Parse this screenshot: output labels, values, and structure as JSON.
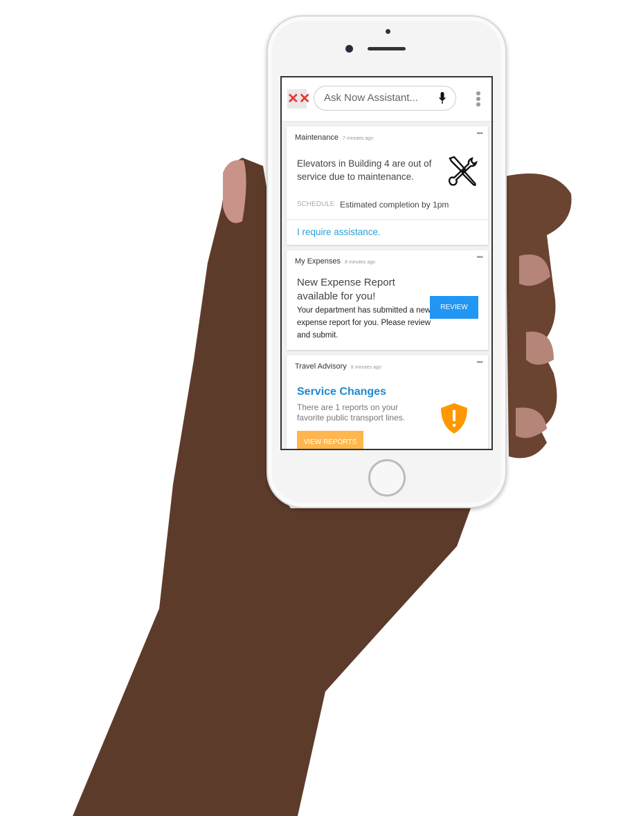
{
  "search": {
    "placeholder": "Ask Now Assistant..."
  },
  "cards": [
    {
      "category": "Maintenance",
      "time": "7 minutes ago",
      "body": "Elevators in Building 4 are out of service due to maintenance.",
      "schedule_label": "SCHEDULE",
      "schedule_text": "Estimated completion by 1pm",
      "link": "I require assistance.",
      "icon": "tools-icon"
    },
    {
      "category": "My Expenses",
      "time": "8 minutes ago",
      "title": "New Expense Report available for you!",
      "body": "Your department has submitted a new expense report for you. Please review and submit.",
      "button": "REVIEW"
    },
    {
      "category": "Travel Advisory",
      "time": "8 minutes ago",
      "title": "Service Changes",
      "body": "There are 1 reports on your favorite public transport lines.",
      "button": "VIEW REPORTS",
      "icon": "warning-shield-icon"
    }
  ],
  "colors": {
    "link": "#2a9fd8",
    "review": "#2196f3",
    "view_reports": "#ffb74d",
    "shield": "#ff9800",
    "title_blue": "#1e88d0",
    "logo": "#e53935",
    "skin": "#5a3a2a"
  }
}
